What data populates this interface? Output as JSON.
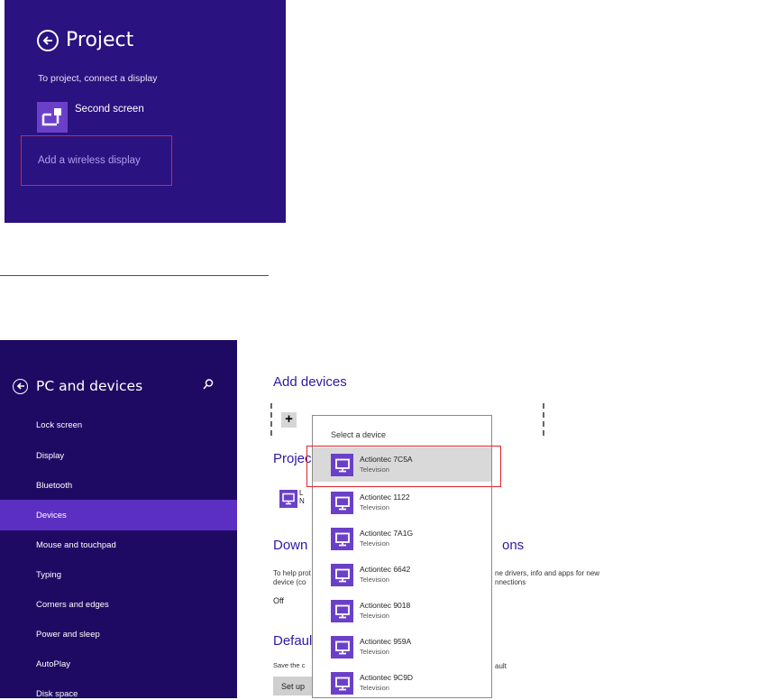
{
  "project": {
    "title": "Project",
    "subtitle": "To project, connect a display",
    "second_screen": "Second screen",
    "add_wireless": "Add a wireless display"
  },
  "pc_settings": {
    "title": "PC and devices",
    "nav": [
      "Lock screen",
      "Display",
      "Bluetooth",
      "Devices",
      "Mouse and touchpad",
      "Typing",
      "Corners and edges",
      "Power and sleep",
      "AutoPlay",
      "Disk space"
    ],
    "selected_nav": "Devices"
  },
  "main": {
    "add_devices_heading": "Add devices",
    "projectors_heading_fragment": "Projec",
    "downloads_heading_fragment_left": "Down",
    "downloads_heading_fragment_right": "ons",
    "downloads_desc_left_1": "To help prot",
    "downloads_desc_left_2": "device (co",
    "downloads_desc_right_1": "ne drivers, info and apps for new",
    "downloads_desc_right_2": "nnections",
    "off_label": "Off",
    "default_heading_fragment": "Defaul",
    "default_desc_left": "Save the c",
    "default_desc_right": "ault",
    "setup_button": "Set up"
  },
  "popup": {
    "title": "Select a device",
    "devices": [
      {
        "name": "Actiontec 7C5A",
        "type": "Television"
      },
      {
        "name": "Actiontec 1122",
        "type": "Television"
      },
      {
        "name": "Actiontec 7A1G",
        "type": "Television"
      },
      {
        "name": "Actiontec 6642",
        "type": "Television"
      },
      {
        "name": "Actiontec 9018",
        "type": "Television"
      },
      {
        "name": "Actiontec 959A",
        "type": "Television"
      },
      {
        "name": "Actiontec 9C9D",
        "type": "Television"
      }
    ],
    "selected_index": 0
  },
  "colors": {
    "charm_bg": "#2a1280",
    "sidebar_bg": "#1f0a63",
    "accent": "#6b40c9",
    "selected_nav": "#5b2fc2",
    "highlight_box": "#e2232a",
    "link_purple": "#b49cf0"
  },
  "icons": {
    "back": "back-arrow-icon",
    "search": "search-icon",
    "projector": "projector-plug-icon",
    "monitor": "monitor-icon",
    "add": "plus-icon"
  }
}
